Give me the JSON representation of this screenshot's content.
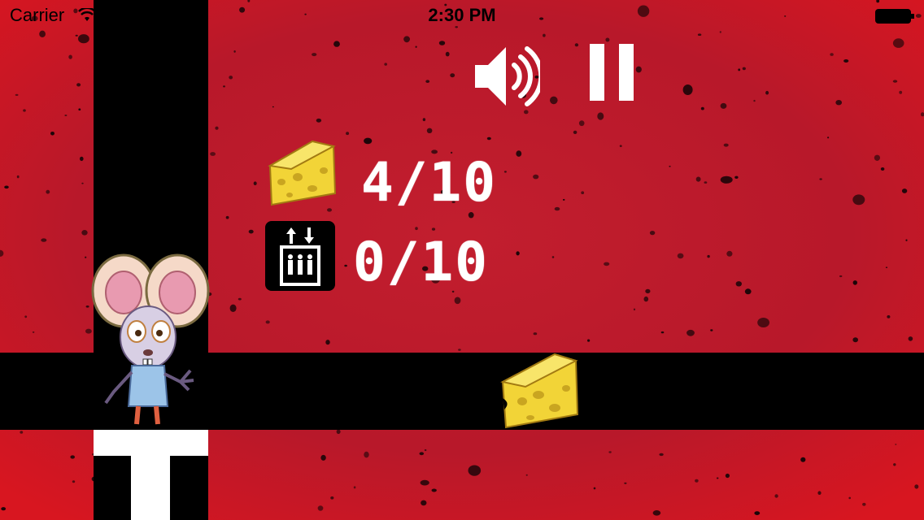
{
  "status_bar": {
    "carrier": "Carrier",
    "time": "2:30 PM",
    "wifi_icon": "wifi-icon",
    "battery_icon": "battery-icon"
  },
  "hud": {
    "sound_icon": "speaker-icon",
    "pause_icon": "pause-icon",
    "cheese": {
      "icon": "cheese-icon",
      "collected": 4,
      "total": 10,
      "label": "4/10"
    },
    "elevator": {
      "icon": "elevator-icon",
      "used": 0,
      "total": 10,
      "label": "0/10"
    }
  },
  "sprites": {
    "player": "mouse-character",
    "pickup": "cheese-pickup"
  },
  "colors": {
    "background": "#c8182a",
    "wall": "#000000",
    "text": "#ffffff",
    "cheese": "#f2d437"
  }
}
